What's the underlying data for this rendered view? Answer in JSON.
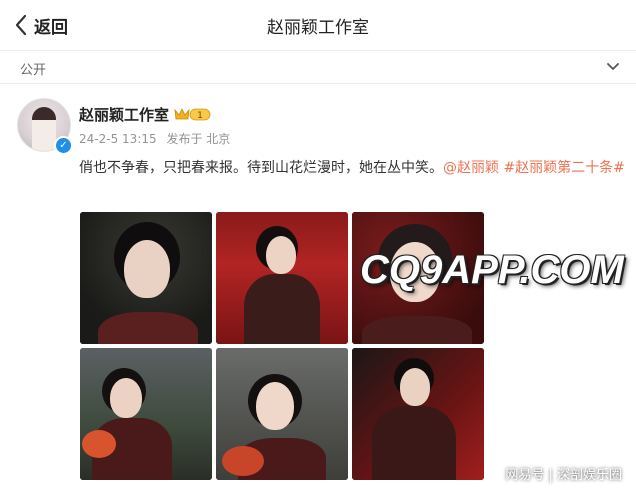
{
  "header": {
    "back_label": "返回",
    "title": "赵丽颖工作室"
  },
  "visibility": {
    "label": "公开"
  },
  "post": {
    "author": "赵丽颖工作室",
    "member_badge_level": "1",
    "date": "24-2-5 13:15",
    "location": "发布于 北京",
    "text_plain": "俏也不争春，只把春来报。待到山花烂漫时，她在丛中笑。",
    "mention": "@赵丽颖",
    "hashtag": "#赵丽颖第二十条#"
  },
  "overlay": {
    "watermark": "CQ9APP.COM",
    "credit": "网易号 | 深剖娱乐圈"
  },
  "colors": {
    "accent": "#eb7350",
    "verified": "#1f8fe8"
  }
}
